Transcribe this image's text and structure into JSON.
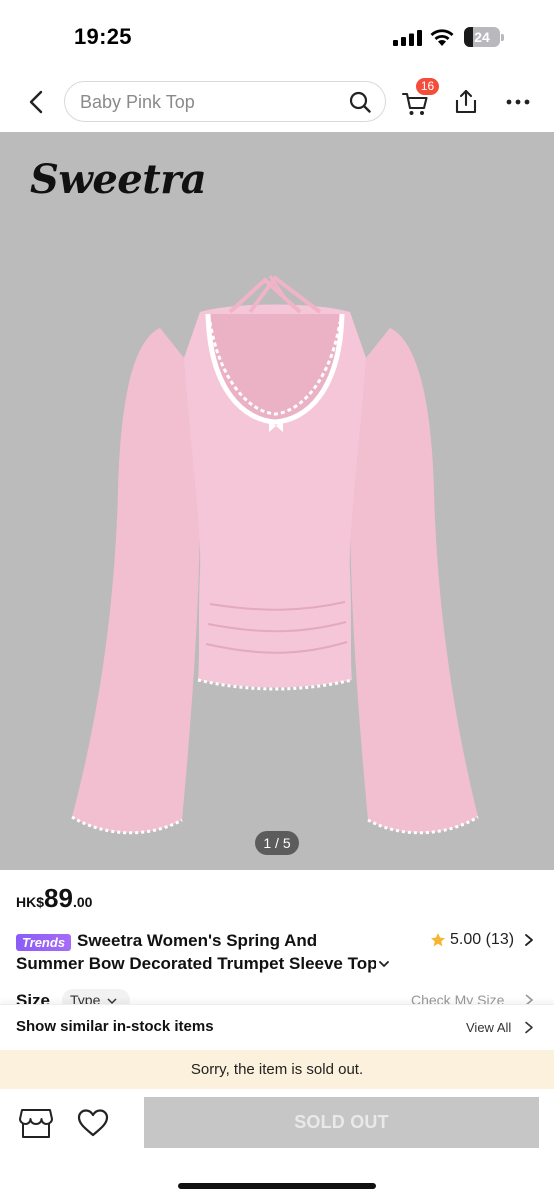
{
  "status_bar": {
    "time": "19:25",
    "battery": "24",
    "battery_level": 0.24
  },
  "nav": {
    "search_placeholder": "Baby Pink Top",
    "cart_count": "16"
  },
  "gallery": {
    "brand": "Sweetra",
    "counter": "1 / 5",
    "garment_color": "#f2bfd1",
    "background_color": "#bcbbbc"
  },
  "product": {
    "price_currency": "HK$",
    "price_int": "89",
    "price_dec": ".00",
    "badge": "Trends",
    "title_line1": "Sweetra Women's Spring And",
    "title_line2": "Summer Bow Decorated Trumpet Sleeve Top",
    "rating": "5.00 (13)"
  },
  "size": {
    "label": "Size",
    "type_chip": "Type",
    "check": "Check My Size"
  },
  "similar": {
    "text": "Show similar in-stock items",
    "view_all": "View All"
  },
  "banner": {
    "message": "Sorry, the item is sold out."
  },
  "bottom": {
    "sold_out_label": "SOLD OUT"
  },
  "colors": {
    "badge_red": "#f34d3c",
    "trends_purple": "#8b5cf6",
    "star_yellow": "#f5b731",
    "soldout_banner": "#fbf1dc",
    "disabled_button": "#c6c6c6"
  }
}
